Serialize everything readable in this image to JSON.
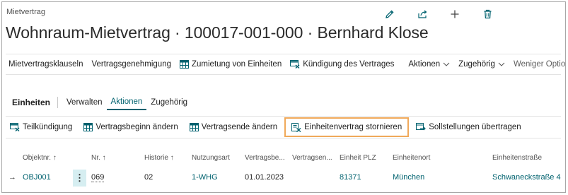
{
  "header": {
    "caption": "Mietvertrag",
    "title": "Wohnraum-Mietvertrag · 100017-001-000 · Bernhard Klose",
    "icons": [
      "edit-icon",
      "share-icon",
      "add-icon",
      "delete-icon"
    ]
  },
  "actions": {
    "items": [
      {
        "label": "Mietvertragsklauseln"
      },
      {
        "label": "Vertragsgenehmigung"
      },
      {
        "label": "Zumietung von Einheiten",
        "icon": "grid-icon"
      },
      {
        "label": "Kündigung des Vertrages",
        "icon": "cancel-contract-icon"
      }
    ],
    "aktionen": "Aktionen",
    "zugehoerig": "Zugehörig",
    "weniger": "Weniger Optionen"
  },
  "part": {
    "title": "Einheiten",
    "tabs": [
      "Verwalten",
      "Aktionen",
      "Zugehörig"
    ],
    "active_tab": "Aktionen",
    "buttons": [
      {
        "label": "Teilkündigung",
        "icon": "cancel-contract-icon"
      },
      {
        "label": "Vertragsbeginn ändern",
        "icon": "grid-icon"
      },
      {
        "label": "Vertragsende ändern",
        "icon": "grid-icon"
      },
      {
        "label": "Einheitenvertrag stornieren",
        "icon": "void-document-icon",
        "highlighted": true
      },
      {
        "label": "Sollstellungen übertragen",
        "icon": "transfer-icon"
      }
    ]
  },
  "table": {
    "columns": [
      "Objektnr.",
      "Nr.",
      "Historie",
      "Nutzungsart",
      "Vertragsbe...",
      "Vertragsen...",
      "Einheit PLZ",
      "Einheitenort",
      "Einheitenstraße"
    ],
    "sort_marker": "↑",
    "row": {
      "objektnr": "OBJ001",
      "nr": "069",
      "historie": "02",
      "nutzungsart": "1-WHG",
      "vertragsbeginn": "01.01.2023",
      "vertragsende": "",
      "plz": "81371",
      "ort": "München",
      "strasse": "Schwaneckstraße 4"
    }
  },
  "colors": {
    "accent": "#00626f",
    "highlight_border": "#f0a95a",
    "selected_cell": "#d6eef1"
  }
}
